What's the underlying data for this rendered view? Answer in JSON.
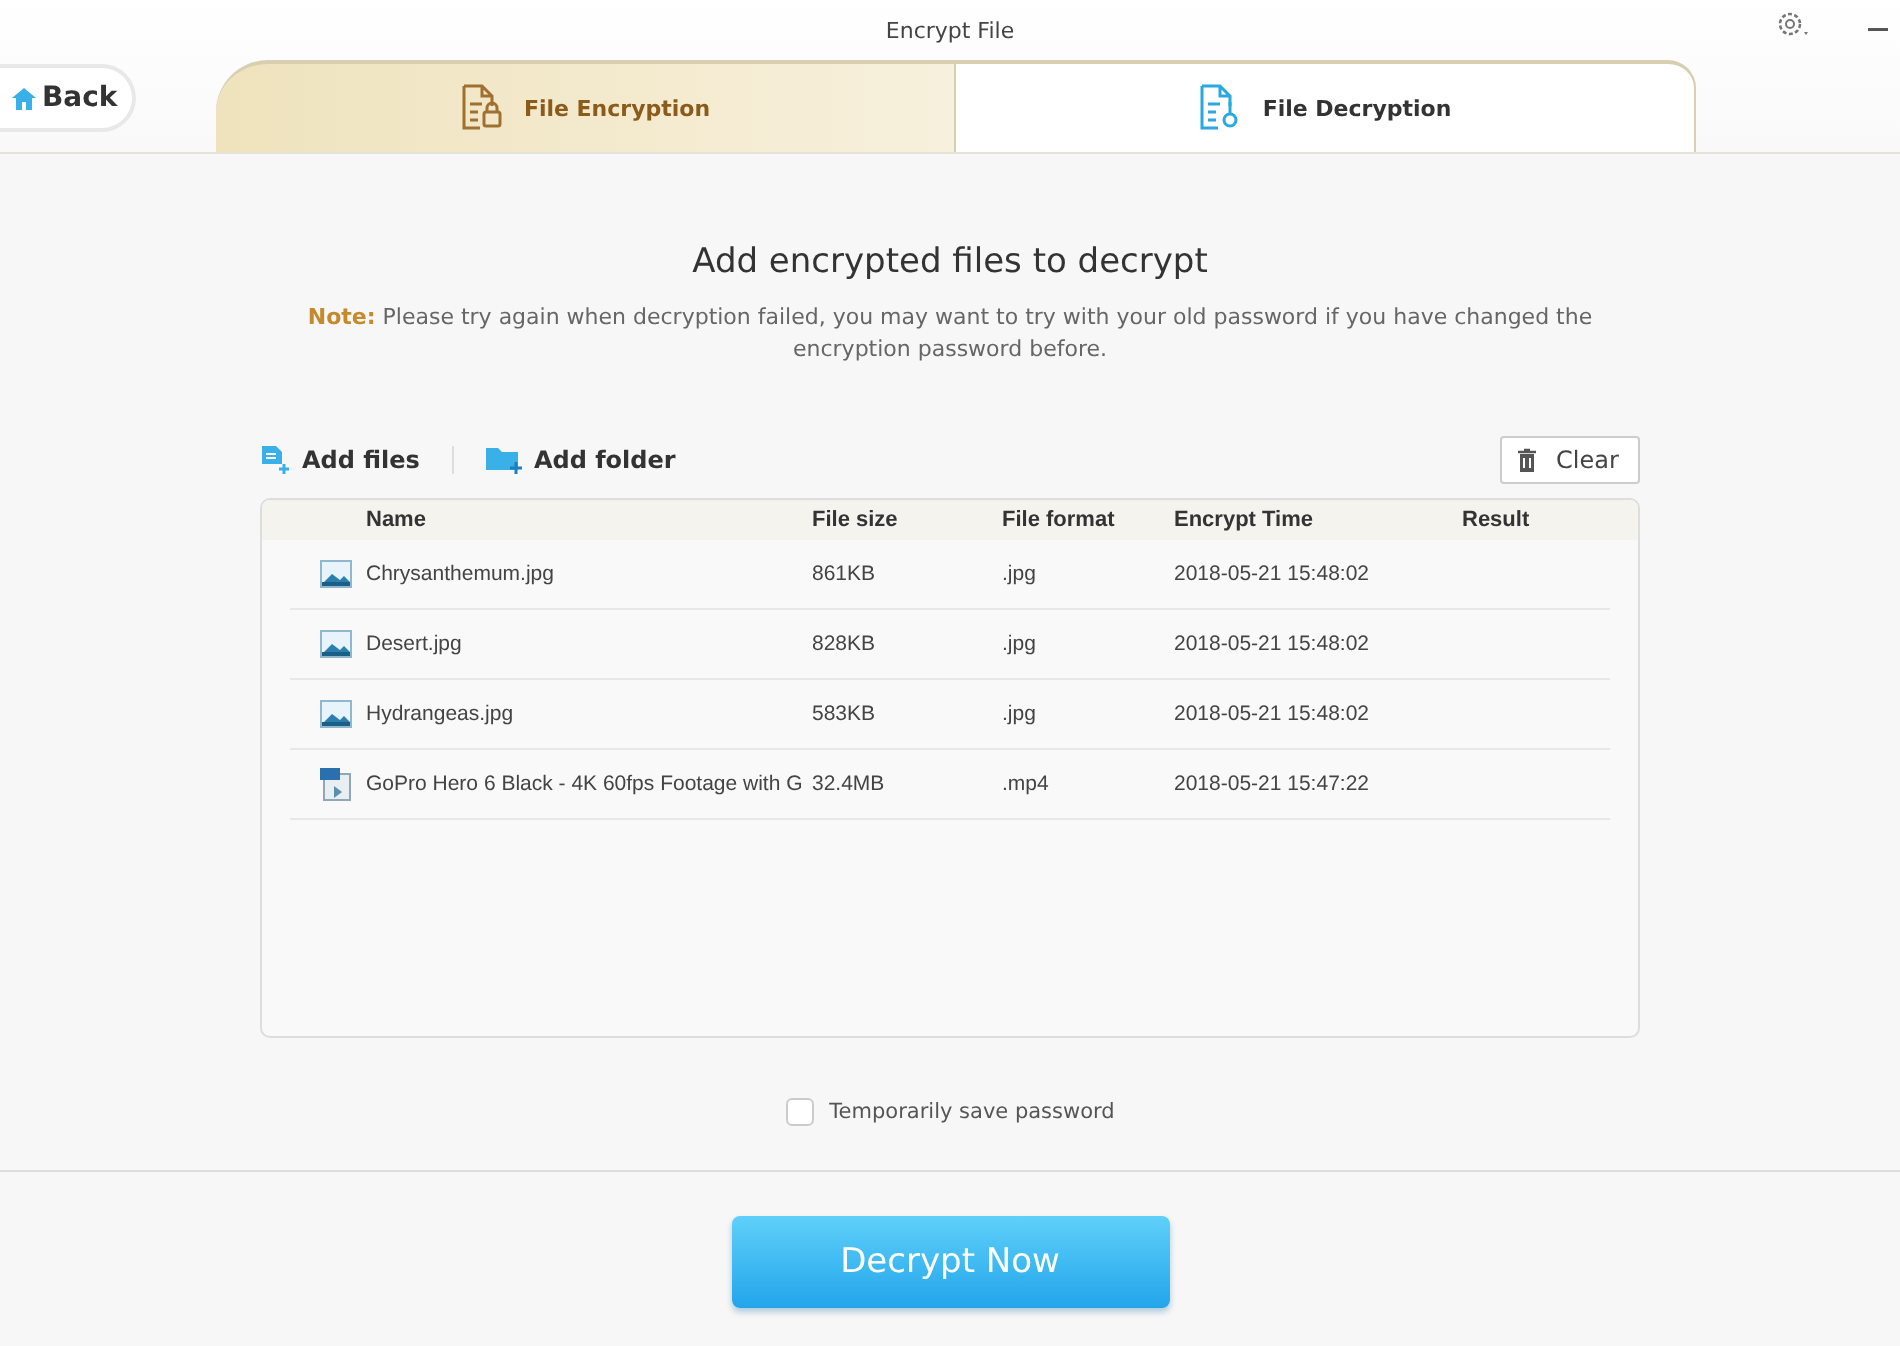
{
  "window": {
    "title": "Encrypt File"
  },
  "back": {
    "label": "Back"
  },
  "tabs": [
    {
      "label": "File Encryption",
      "kind": "encrypt",
      "selected": false
    },
    {
      "label": "File Decryption",
      "kind": "decrypt",
      "selected": true
    }
  ],
  "heading": "Add encrypted files to decrypt",
  "note": "**Note:** Please try again when decryption failed, you may want to try with your old password if you have changed the encryption password before.",
  "toolbar": {
    "add_files": "Add files",
    "add_folder": "Add folder",
    "clear": "Clear"
  },
  "table": {
    "columns": [
      "Name",
      "File size",
      "File format",
      "Encrypt Time",
      "Result"
    ],
    "rows": [
      {
        "kind": "image",
        "cells": [
          "Chrysanthemum.jpg",
          "861KB",
          ".jpg",
          "2018-05-21 15:48:02"
        ]
      },
      {
        "kind": "image",
        "cells": [
          "Desert.jpg",
          "828KB",
          ".jpg",
          "2018-05-21 15:48:02"
        ]
      },
      {
        "kind": "image",
        "cells": [
          "Hydrangeas.jpg",
          "583KB",
          ".jpg",
          "2018-05-21 15:48:02"
        ]
      },
      {
        "kind": "video",
        "cells": [
          "GoPro Hero 6 Black - 4K 60fps Footage with G",
          "32.4MB",
          ".mp4",
          "2018-05-21 15:47:22"
        ]
      }
    ]
  },
  "save_password": {
    "label": "Temporarily save password",
    "checked": false
  },
  "action": {
    "label": "Decrypt Now"
  }
}
